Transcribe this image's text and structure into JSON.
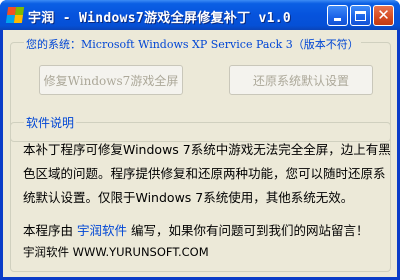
{
  "window": {
    "title": "宇润 - Windows7游戏全屏修复补丁 v1.0",
    "icon": "windows-flag-icon"
  },
  "titlebar_buttons": {
    "minimize_icon": "minimize-icon",
    "maximize_icon": "maximize-icon",
    "close_icon": "close-icon",
    "close_color": "#d44b22"
  },
  "system_group": {
    "legend": "您的系统：Microsoft Windows XP Service Pack 3（版本不符）"
  },
  "buttons": {
    "fix_label": "修复Windows7游戏全屏",
    "restore_label": "还原系统默认设置"
  },
  "description_group": {
    "legend": "软件说明",
    "paragraph": "本补丁程序可修复Windows 7系统中游戏无法完全全屏，边上有黑色区域的问题。程序提供修复和还原两种功能，您可以随时还原系统默认设置。仅限于Windows 7系统使用，其他系统无效。",
    "credit_prefix": "本程序由",
    "credit_link": "宇润软件",
    "credit_suffix": "编写，如果你有问题可到我们的网站留言！",
    "website_line": "宇润软件 WWW.YURUNSOFT.COM"
  },
  "colors": {
    "titlebar": "#0653dd",
    "accent_text": "#0046d5",
    "dialog_bg": "#ece9d8",
    "disabled_text": "#aca899"
  }
}
